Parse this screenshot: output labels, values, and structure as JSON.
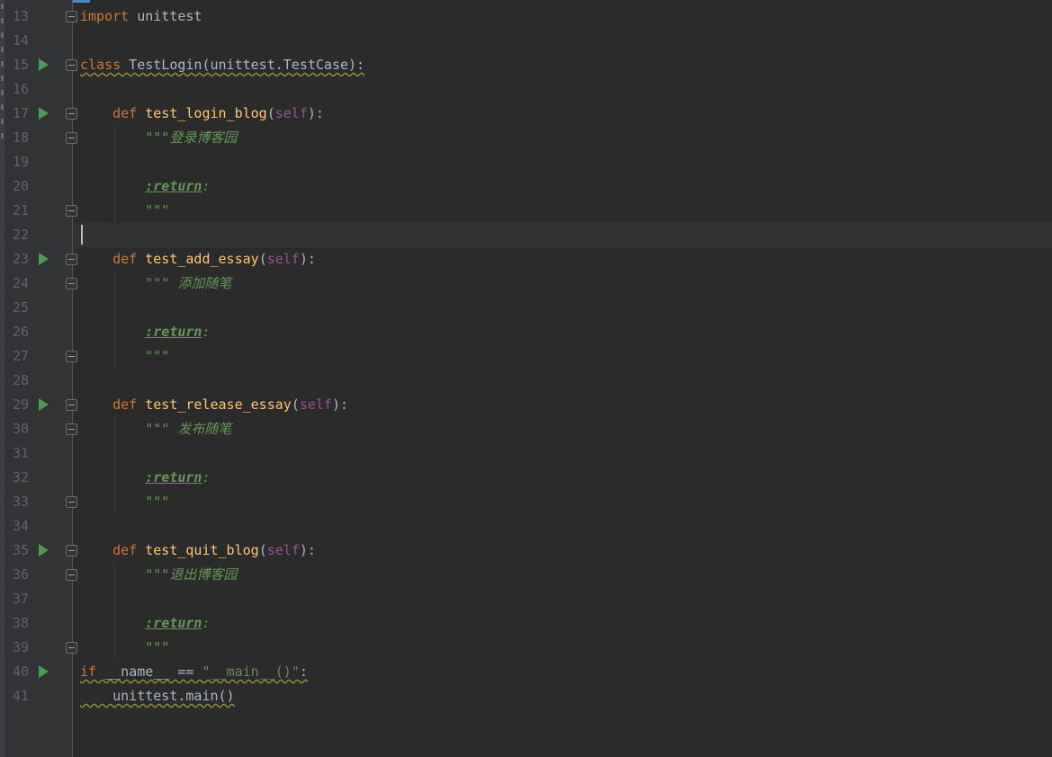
{
  "editor": {
    "lines": [
      {
        "num": "13",
        "segments": [
          {
            "t": "import",
            "c": "kw"
          },
          {
            "t": " unittest",
            "c": ""
          }
        ],
        "fold": true,
        "run": false
      },
      {
        "num": "14",
        "segments": [],
        "fold": false,
        "run": false
      },
      {
        "num": "15",
        "segments": [
          {
            "t": "class",
            "c": "kw wavy"
          },
          {
            "t": " TestLogin(unittest.TestCase):",
            "c": "wavy"
          }
        ],
        "fold": true,
        "run": true
      },
      {
        "num": "16",
        "segments": [],
        "fold": false,
        "run": false
      },
      {
        "num": "17",
        "segments": [
          {
            "t": "    ",
            "c": ""
          },
          {
            "t": "def",
            "c": "kw"
          },
          {
            "t": " ",
            "c": ""
          },
          {
            "t": "test_login_blog",
            "c": "fn"
          },
          {
            "t": "(",
            "c": ""
          },
          {
            "t": "self",
            "c": "self"
          },
          {
            "t": "):",
            "c": ""
          }
        ],
        "fold": true,
        "run": true
      },
      {
        "num": "18",
        "segments": [
          {
            "t": "        ",
            "c": ""
          },
          {
            "t": "\"\"\"登录博客园",
            "c": "doc"
          }
        ],
        "fold": true,
        "run": false
      },
      {
        "num": "19",
        "segments": [],
        "fold": false,
        "run": false
      },
      {
        "num": "20",
        "segments": [
          {
            "t": "        ",
            "c": ""
          },
          {
            "t": ":return",
            "c": "tag"
          },
          {
            "t": ":",
            "c": "doc"
          }
        ],
        "fold": false,
        "run": false
      },
      {
        "num": "21",
        "segments": [
          {
            "t": "        ",
            "c": ""
          },
          {
            "t": "\"\"\"",
            "c": "doc"
          }
        ],
        "fold": true,
        "run": false
      },
      {
        "num": "22",
        "segments": [],
        "fold": false,
        "run": false,
        "current": true
      },
      {
        "num": "23",
        "segments": [
          {
            "t": "    ",
            "c": ""
          },
          {
            "t": "def",
            "c": "kw"
          },
          {
            "t": " ",
            "c": ""
          },
          {
            "t": "test_add_essay",
            "c": "fn"
          },
          {
            "t": "(",
            "c": ""
          },
          {
            "t": "self",
            "c": "self"
          },
          {
            "t": "):",
            "c": ""
          }
        ],
        "fold": true,
        "run": true
      },
      {
        "num": "24",
        "segments": [
          {
            "t": "        ",
            "c": ""
          },
          {
            "t": "\"\"\" 添加随笔",
            "c": "doc"
          }
        ],
        "fold": true,
        "run": false
      },
      {
        "num": "25",
        "segments": [],
        "fold": false,
        "run": false
      },
      {
        "num": "26",
        "segments": [
          {
            "t": "        ",
            "c": ""
          },
          {
            "t": ":return",
            "c": "tag"
          },
          {
            "t": ":",
            "c": "doc"
          }
        ],
        "fold": false,
        "run": false
      },
      {
        "num": "27",
        "segments": [
          {
            "t": "        ",
            "c": ""
          },
          {
            "t": "\"\"\"",
            "c": "doc"
          }
        ],
        "fold": true,
        "run": false
      },
      {
        "num": "28",
        "segments": [],
        "fold": false,
        "run": false
      },
      {
        "num": "29",
        "segments": [
          {
            "t": "    ",
            "c": ""
          },
          {
            "t": "def",
            "c": "kw"
          },
          {
            "t": " ",
            "c": ""
          },
          {
            "t": "test_release_essay",
            "c": "fn"
          },
          {
            "t": "(",
            "c": ""
          },
          {
            "t": "self",
            "c": "self"
          },
          {
            "t": "):",
            "c": ""
          }
        ],
        "fold": true,
        "run": true
      },
      {
        "num": "30",
        "segments": [
          {
            "t": "        ",
            "c": ""
          },
          {
            "t": "\"\"\" 发布随笔",
            "c": "doc"
          }
        ],
        "fold": true,
        "run": false
      },
      {
        "num": "31",
        "segments": [],
        "fold": false,
        "run": false
      },
      {
        "num": "32",
        "segments": [
          {
            "t": "        ",
            "c": ""
          },
          {
            "t": ":return",
            "c": "tag"
          },
          {
            "t": ":",
            "c": "doc"
          }
        ],
        "fold": false,
        "run": false
      },
      {
        "num": "33",
        "segments": [
          {
            "t": "        ",
            "c": ""
          },
          {
            "t": "\"\"\"",
            "c": "doc"
          }
        ],
        "fold": true,
        "run": false
      },
      {
        "num": "34",
        "segments": [],
        "fold": false,
        "run": false
      },
      {
        "num": "35",
        "segments": [
          {
            "t": "    ",
            "c": ""
          },
          {
            "t": "def",
            "c": "kw"
          },
          {
            "t": " ",
            "c": ""
          },
          {
            "t": "test_quit_blog",
            "c": "fn"
          },
          {
            "t": "(",
            "c": ""
          },
          {
            "t": "self",
            "c": "self"
          },
          {
            "t": "):",
            "c": ""
          }
        ],
        "fold": true,
        "run": true
      },
      {
        "num": "36",
        "segments": [
          {
            "t": "        ",
            "c": ""
          },
          {
            "t": "\"\"\"退出博客园",
            "c": "doc"
          }
        ],
        "fold": true,
        "run": false
      },
      {
        "num": "37",
        "segments": [],
        "fold": false,
        "run": false
      },
      {
        "num": "38",
        "segments": [
          {
            "t": "        ",
            "c": ""
          },
          {
            "t": ":return",
            "c": "tag"
          },
          {
            "t": ":",
            "c": "doc"
          }
        ],
        "fold": false,
        "run": false
      },
      {
        "num": "39",
        "segments": [
          {
            "t": "        ",
            "c": ""
          },
          {
            "t": "\"\"\"",
            "c": "doc"
          }
        ],
        "fold": true,
        "run": false
      },
      {
        "num": "40",
        "segments": [
          {
            "t": "if",
            "c": "kw wavy"
          },
          {
            "t": " __name__ == ",
            "c": "wavy"
          },
          {
            "t": "\"__main__()\"",
            "c": "str wavy"
          },
          {
            "t": ":",
            "c": "wavy"
          }
        ],
        "fold": false,
        "run": true
      },
      {
        "num": "41",
        "segments": [
          {
            "t": "    unittest.main()",
            "c": "wavy"
          }
        ],
        "fold": false,
        "run": false
      }
    ]
  },
  "colors": {
    "background": "#2b2b2b",
    "gutter": "#313335",
    "keyword": "#cc7832",
    "function": "#ffc66d",
    "self": "#94558d",
    "docstring": "#629755",
    "string": "#6a8759",
    "run_icon": "#499c54"
  },
  "icons": {
    "run": "run-gutter-icon",
    "fold": "fold-marker-icon"
  }
}
